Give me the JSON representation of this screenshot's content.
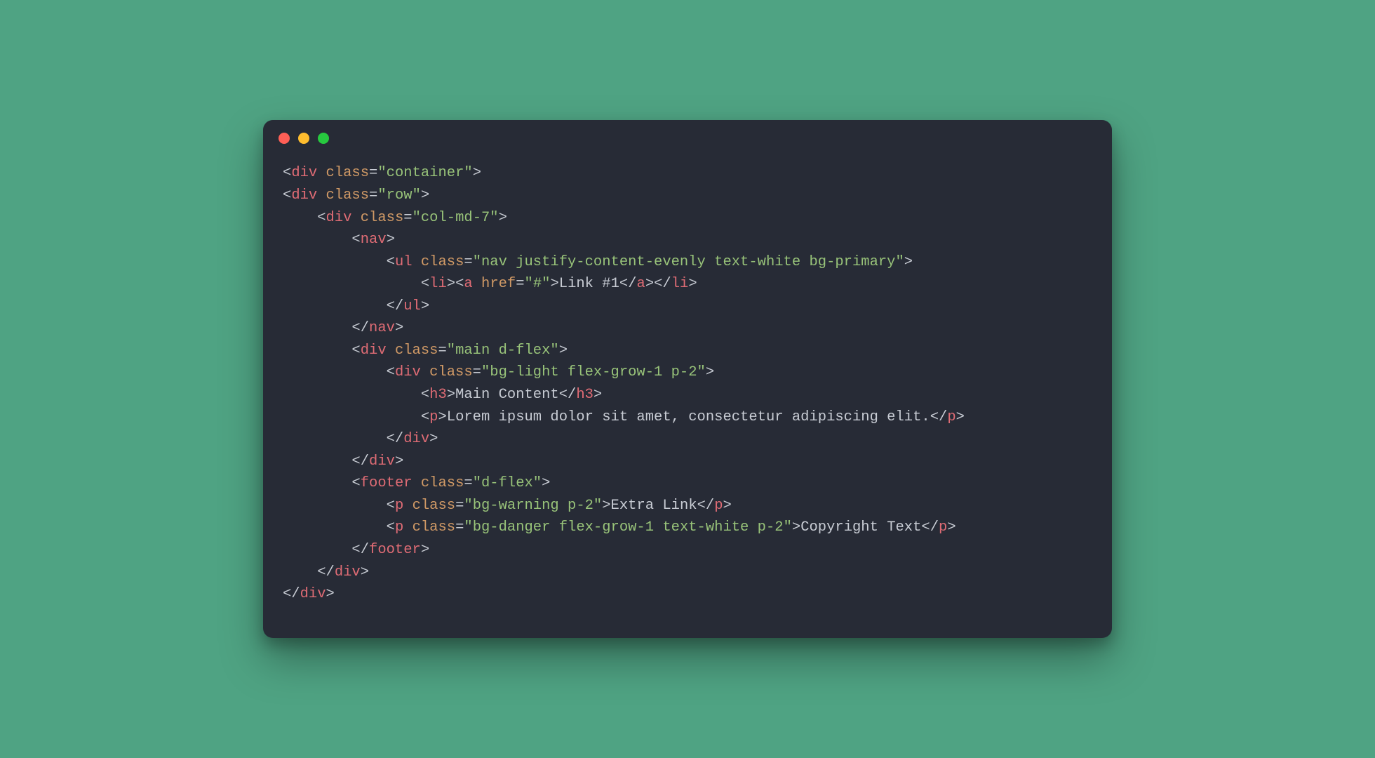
{
  "code": {
    "lines": [
      {
        "indent": 0,
        "kind": "open",
        "tag": "div",
        "attrs": [
          [
            "class",
            "container"
          ]
        ]
      },
      {
        "indent": 0,
        "kind": "open",
        "tag": "div",
        "attrs": [
          [
            "class",
            "row"
          ]
        ]
      },
      {
        "indent": 1,
        "kind": "open",
        "tag": "div",
        "attrs": [
          [
            "class",
            "col-md-7"
          ]
        ]
      },
      {
        "indent": 2,
        "kind": "open",
        "tag": "nav",
        "attrs": []
      },
      {
        "indent": 3,
        "kind": "open",
        "tag": "ul",
        "attrs": [
          [
            "class",
            "nav justify-content-evenly text-white bg-primary"
          ]
        ]
      },
      {
        "indent": 4,
        "kind": "li-a",
        "href": "#",
        "text": "Link #1"
      },
      {
        "indent": 3,
        "kind": "close",
        "tag": "ul"
      },
      {
        "indent": 2,
        "kind": "close",
        "tag": "nav"
      },
      {
        "indent": 2,
        "kind": "open",
        "tag": "div",
        "attrs": [
          [
            "class",
            "main d-flex"
          ]
        ]
      },
      {
        "indent": 3,
        "kind": "open",
        "tag": "div",
        "attrs": [
          [
            "class",
            "bg-light flex-grow-1 p-2"
          ]
        ]
      },
      {
        "indent": 4,
        "kind": "elem",
        "tag": "h3",
        "text": "Main Content"
      },
      {
        "indent": 4,
        "kind": "elem",
        "tag": "p",
        "text": "Lorem ipsum dolor sit amet, consectetur adipiscing elit."
      },
      {
        "indent": 3,
        "kind": "close",
        "tag": "div"
      },
      {
        "indent": 2,
        "kind": "close",
        "tag": "div"
      },
      {
        "indent": 2,
        "kind": "open",
        "tag": "footer",
        "attrs": [
          [
            "class",
            "d-flex"
          ]
        ]
      },
      {
        "indent": 3,
        "kind": "elem",
        "tag": "p",
        "attrs": [
          [
            "class",
            "bg-warning p-2"
          ]
        ],
        "text": "Extra Link"
      },
      {
        "indent": 3,
        "kind": "elem",
        "tag": "p",
        "attrs": [
          [
            "class",
            "bg-danger flex-grow-1 text-white p-2"
          ]
        ],
        "text": "Copyright Text"
      },
      {
        "indent": 2,
        "kind": "close",
        "tag": "footer"
      },
      {
        "indent": 1,
        "kind": "close",
        "tag": "div"
      },
      {
        "indent": 0,
        "kind": "close",
        "tag": "div"
      }
    ]
  }
}
